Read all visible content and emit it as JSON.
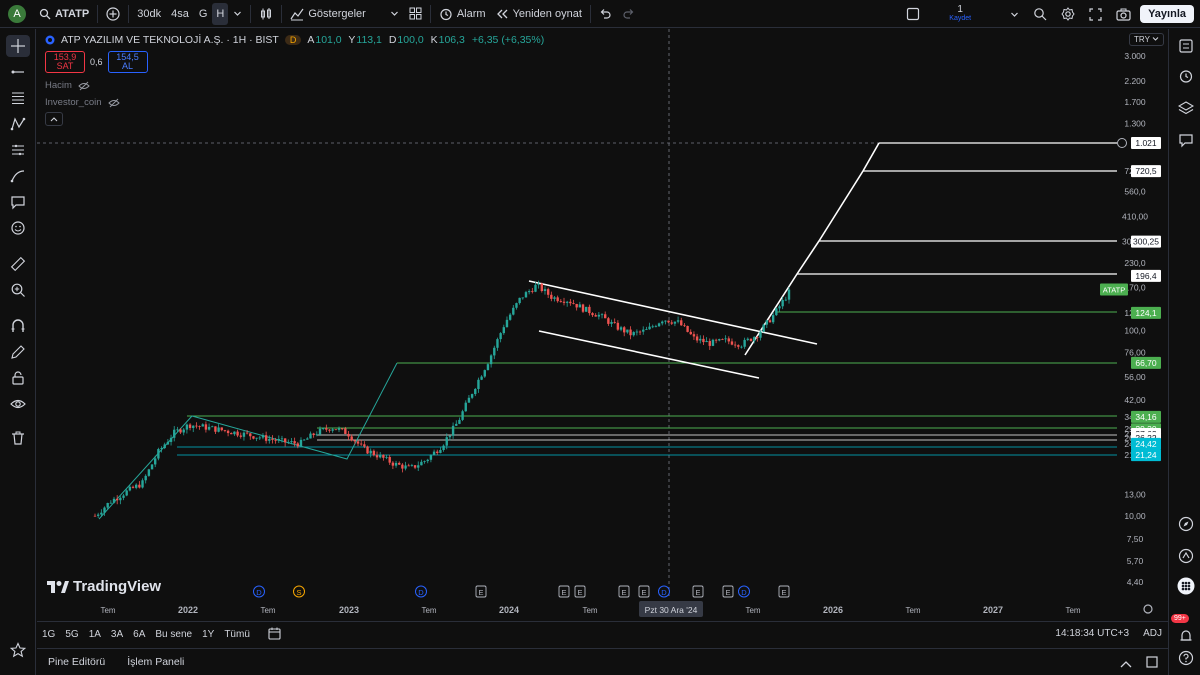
{
  "topbar": {
    "avatar_letter": "A",
    "symbol": "ATATP",
    "intervals": [
      "30dk",
      "4sa",
      "G",
      "H"
    ],
    "indicators_label": "Göstergeler",
    "alert_label": "Alarm",
    "replay_label": "Yeniden oynat",
    "save_count": "1",
    "save_label": "Kaydet",
    "publish_label": "Yayınla"
  },
  "legend": {
    "title": "ATP YAZILIM VE TEKNOLOJİ A.Ş. · 1H · BIST",
    "badge": "D",
    "ohlc": [
      {
        "k": "A",
        "v": "101,0"
      },
      {
        "k": "Y",
        "v": "113,1"
      },
      {
        "k": "D",
        "v": "100,0"
      },
      {
        "k": "K",
        "v": "106,3"
      }
    ],
    "change": "+6,35 (+6,35%)",
    "sell_price": "153,9",
    "sell_label": "SAT",
    "spread": "0,6",
    "buy_price": "154,5",
    "buy_label": "AL",
    "indicator1": "Hacim",
    "indicator2": "Investor_coin"
  },
  "currency": "TRY",
  "brand": "TradingView",
  "chart_data": {
    "type": "candlestick",
    "symbol": "ATATP",
    "interval": "1H",
    "scale": "log",
    "price_axis_ticks": [
      "3.000",
      "2.200",
      "1.700",
      "1.300",
      "720,5",
      "560,0",
      "410,00",
      "300,25",
      "230,0",
      "170,0",
      "124,1",
      "100,0",
      "76,00",
      "56,00",
      "42,00",
      "34,16",
      "29,30",
      "27,62",
      "26,22",
      "24,42",
      "21,24",
      "13,00",
      "10,00",
      "7,50",
      "5,70",
      "4,40"
    ],
    "time_axis_labels": [
      "Tem",
      "2022",
      "Tem",
      "2023",
      "Tem",
      "2024",
      "Tem",
      "Pzt 30 Ara '24",
      "Tem",
      "2026",
      "Tem",
      "2027",
      "Tem"
    ],
    "price_labels": [
      {
        "text": "1.021",
        "color": "#ffffff"
      },
      {
        "text": "720,5",
        "color": "#ffffff"
      },
      {
        "text": "300,25",
        "color": "#ffffff"
      },
      {
        "text": "196,4",
        "color": "#ffffff"
      },
      {
        "text": "124,1",
        "color": "#4caf50"
      },
      {
        "text": "66,70",
        "color": "#4caf50"
      },
      {
        "text": "34,16",
        "color": "#4caf50"
      },
      {
        "text": "29,30",
        "color": "#4caf50"
      },
      {
        "text": "27,62",
        "color": "#ffffff"
      },
      {
        "text": "26,22",
        "color": "#ffffff"
      },
      {
        "text": "24,42",
        "color": "#00bcd4"
      },
      {
        "text": "21,24",
        "color": "#00bcd4"
      }
    ],
    "last_price_symbol_tag": "ATATP",
    "event_markers": [
      "D",
      "S",
      "D",
      "E",
      "E",
      "E",
      "E",
      "E",
      "D",
      "E",
      "E",
      "D",
      "E"
    ],
    "series": [
      {
        "t": 0,
        "v": 10
      },
      {
        "t": 1,
        "v": 12
      },
      {
        "t": 2,
        "v": 13.5
      },
      {
        "t": 3,
        "v": 15
      },
      {
        "t": 4,
        "v": 22
      },
      {
        "t": 5,
        "v": 28
      },
      {
        "t": 6,
        "v": 31
      },
      {
        "t": 7,
        "v": 30
      },
      {
        "t": 8,
        "v": 29
      },
      {
        "t": 9,
        "v": 28
      },
      {
        "t": 10,
        "v": 27
      },
      {
        "t": 11,
        "v": 26
      },
      {
        "t": 12,
        "v": 25
      },
      {
        "t": 13,
        "v": 24.5
      },
      {
        "t": 14,
        "v": 28
      },
      {
        "t": 15,
        "v": 30
      },
      {
        "t": 16,
        "v": 28
      },
      {
        "t": 17,
        "v": 23
      },
      {
        "t": 18,
        "v": 21
      },
      {
        "t": 19,
        "v": 19
      },
      {
        "t": 20,
        "v": 18
      },
      {
        "t": 21,
        "v": 20
      },
      {
        "t": 22,
        "v": 24
      },
      {
        "t": 23,
        "v": 32
      },
      {
        "t": 24,
        "v": 48
      },
      {
        "t": 25,
        "v": 70
      },
      {
        "t": 26,
        "v": 110
      },
      {
        "t": 27,
        "v": 150
      },
      {
        "t": 28,
        "v": 175
      },
      {
        "t": 29,
        "v": 150
      },
      {
        "t": 30,
        "v": 145
      },
      {
        "t": 31,
        "v": 130
      },
      {
        "t": 32,
        "v": 120
      },
      {
        "t": 33,
        "v": 105
      },
      {
        "t": 34,
        "v": 95
      },
      {
        "t": 35,
        "v": 100
      },
      {
        "t": 36,
        "v": 115
      },
      {
        "t": 37,
        "v": 110
      },
      {
        "t": 38,
        "v": 90
      },
      {
        "t": 39,
        "v": 85
      },
      {
        "t": 40,
        "v": 88
      },
      {
        "t": 41,
        "v": 84
      },
      {
        "t": 42,
        "v": 95
      },
      {
        "t": 43,
        "v": 120
      },
      {
        "t": 44,
        "v": 160
      }
    ]
  },
  "bottombar": {
    "ranges": [
      "1G",
      "5G",
      "1A",
      "3A",
      "6A",
      "Bu sene",
      "1Y",
      "Tümü"
    ],
    "clock": "14:18:34 UTC+3",
    "adj": "ADJ"
  },
  "panels": {
    "pine": "Pine Editörü",
    "trade": "İşlem Paneli"
  },
  "right_badge": "99+"
}
